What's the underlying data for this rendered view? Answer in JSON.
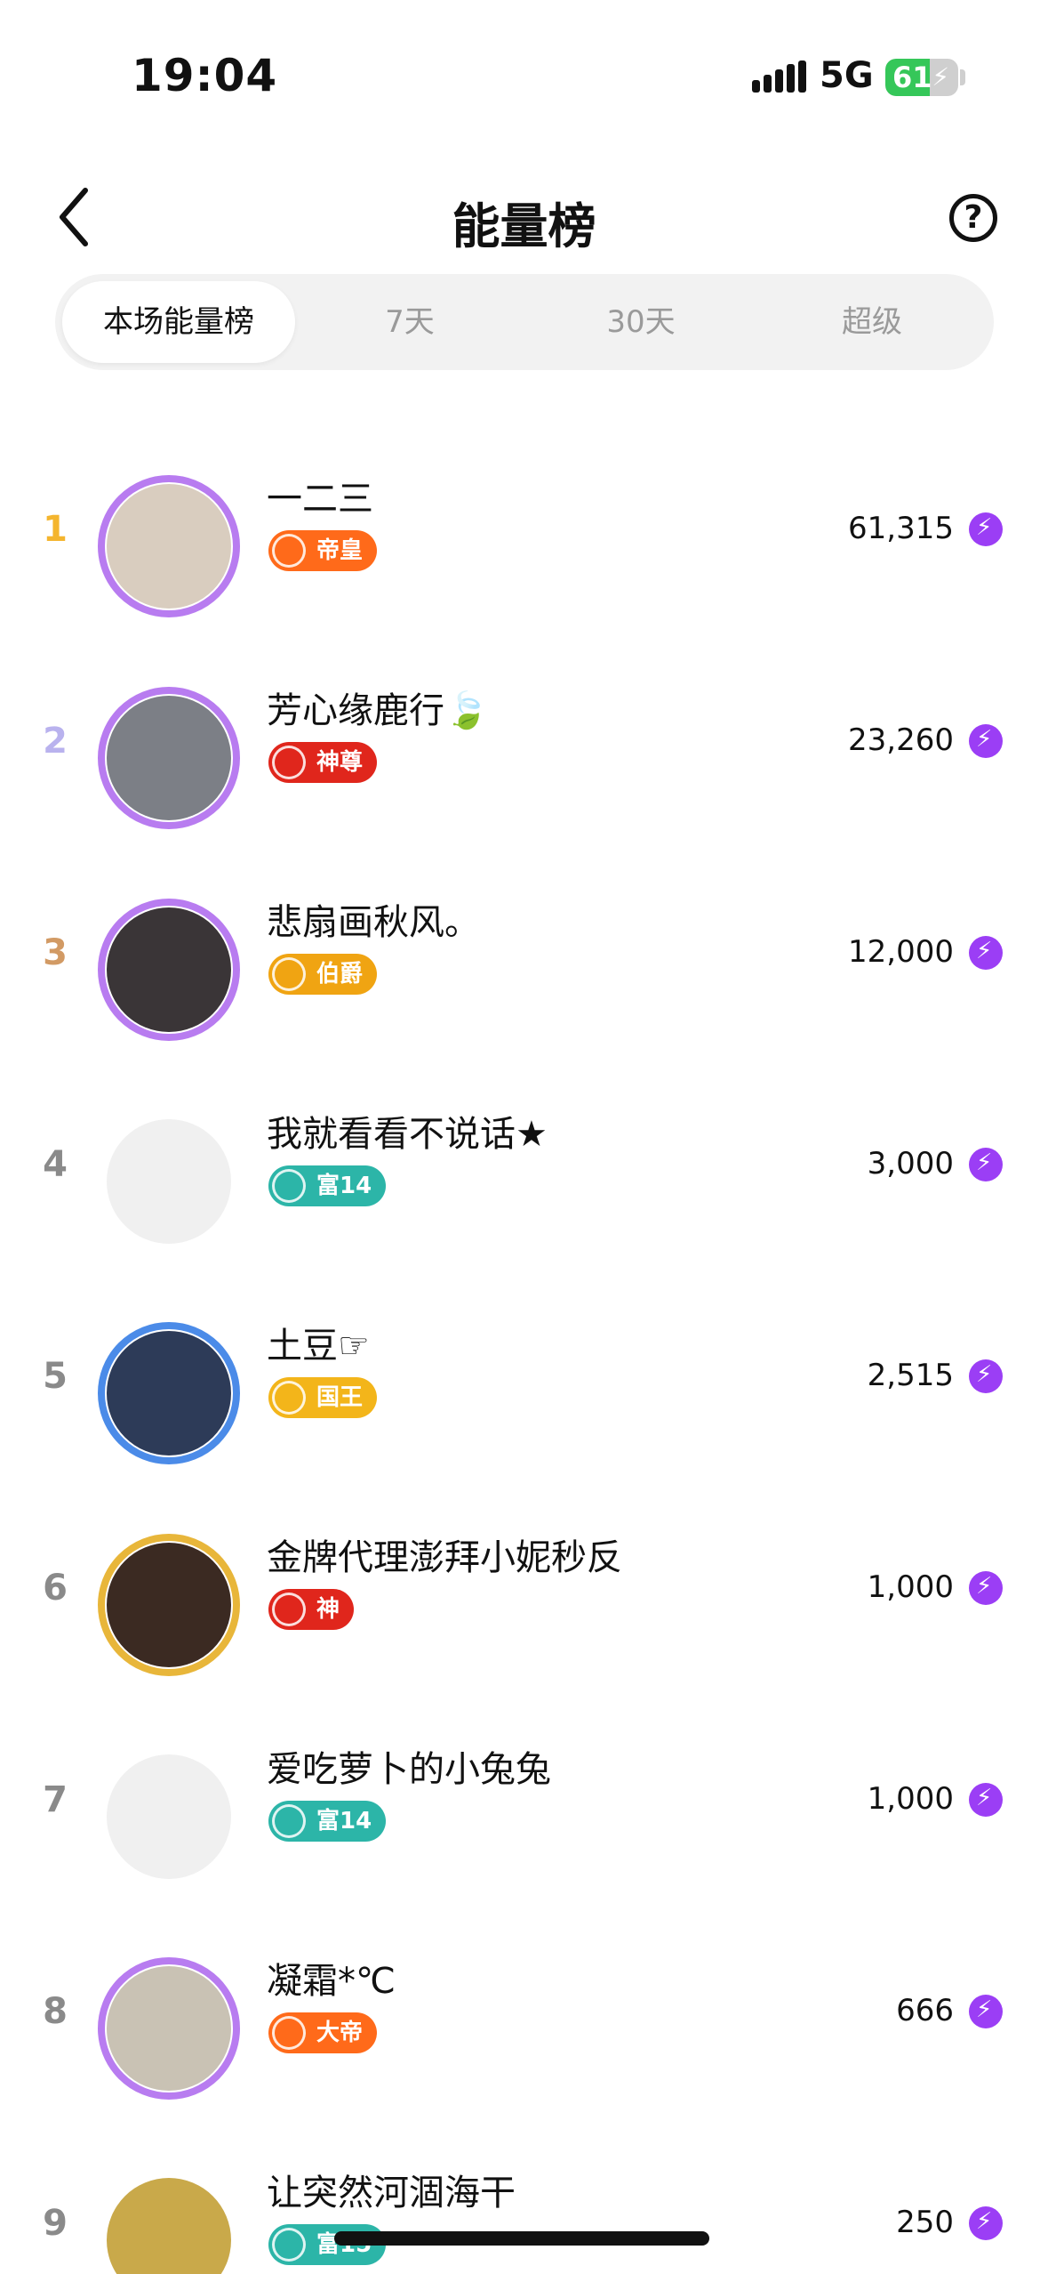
{
  "status": {
    "time": "19:04",
    "network": "5G",
    "battery": "61",
    "battery_level": 0.61
  },
  "header": {
    "title": "能量榜",
    "back_icon": "chevron-left-icon",
    "help_icon": "question-circle-icon",
    "help_glyph": "?"
  },
  "tabs": [
    {
      "label": "本场能量榜",
      "active": true
    },
    {
      "label": "7天",
      "active": false
    },
    {
      "label": "30天",
      "active": false
    },
    {
      "label": "超级",
      "active": false
    }
  ],
  "rows": [
    {
      "rank": "1",
      "name": "一二三",
      "badge": "帝皇",
      "score": "61,315",
      "rank_color": "#f4b52e",
      "badge_color": "#ff6a1a",
      "avatar_bg": "#d9cdbf",
      "ring": "#b87cf0"
    },
    {
      "rank": "2",
      "name": "芳心缘鹿行🍃",
      "badge": "神尊",
      "score": "23,260",
      "rank_color": "#b9b2ee",
      "badge_color": "#e0261c",
      "avatar_bg": "#7c7f86",
      "ring": "#b87cf0"
    },
    {
      "rank": "3",
      "name": "悲扇画秋风。",
      "badge": "伯爵",
      "score": "12,000",
      "rank_color": "#d29a64",
      "badge_color": "#f0a412",
      "avatar_bg": "#3a3537",
      "ring": "#b87cf0"
    },
    {
      "rank": "4",
      "name": "我就看看不说话★",
      "badge": "富14",
      "score": "3,000",
      "rank_color": "#8a8a8a",
      "badge_color": "#2cb5a8",
      "avatar_bg": "#f0f0f0",
      "ring": "none"
    },
    {
      "rank": "5",
      "name": "土豆☞",
      "badge": "国王",
      "score": "2,515",
      "rank_color": "#8a8a8a",
      "badge_color": "#f3b51a",
      "avatar_bg": "#2d3b58",
      "ring": "#4b8be8"
    },
    {
      "rank": "6",
      "name": "金牌代理澎拜小妮秒反",
      "badge": "神",
      "score": "1,000",
      "rank_color": "#8a8a8a",
      "badge_color": "#e0261c",
      "avatar_bg": "#3b2a22",
      "ring": "#e8b63a"
    },
    {
      "rank": "7",
      "name": "爱吃萝卜的小兔兔",
      "badge": "富14",
      "score": "1,000",
      "rank_color": "#8a8a8a",
      "badge_color": "#2cb5a8",
      "avatar_bg": "#f0f0f0",
      "ring": "none"
    },
    {
      "rank": "8",
      "name": "凝霜*℃",
      "badge": "大帝",
      "score": "666",
      "rank_color": "#8a8a8a",
      "badge_color": "#ff6a1a",
      "avatar_bg": "#c9c2b4",
      "ring": "#b87cf0"
    },
    {
      "rank": "9",
      "name": "让突然河涸海干",
      "badge": "富15",
      "score": "250",
      "rank_color": "#8a8a8a",
      "badge_color": "#2cb5a8",
      "avatar_bg": "#c9a94a",
      "ring": "none"
    }
  ]
}
